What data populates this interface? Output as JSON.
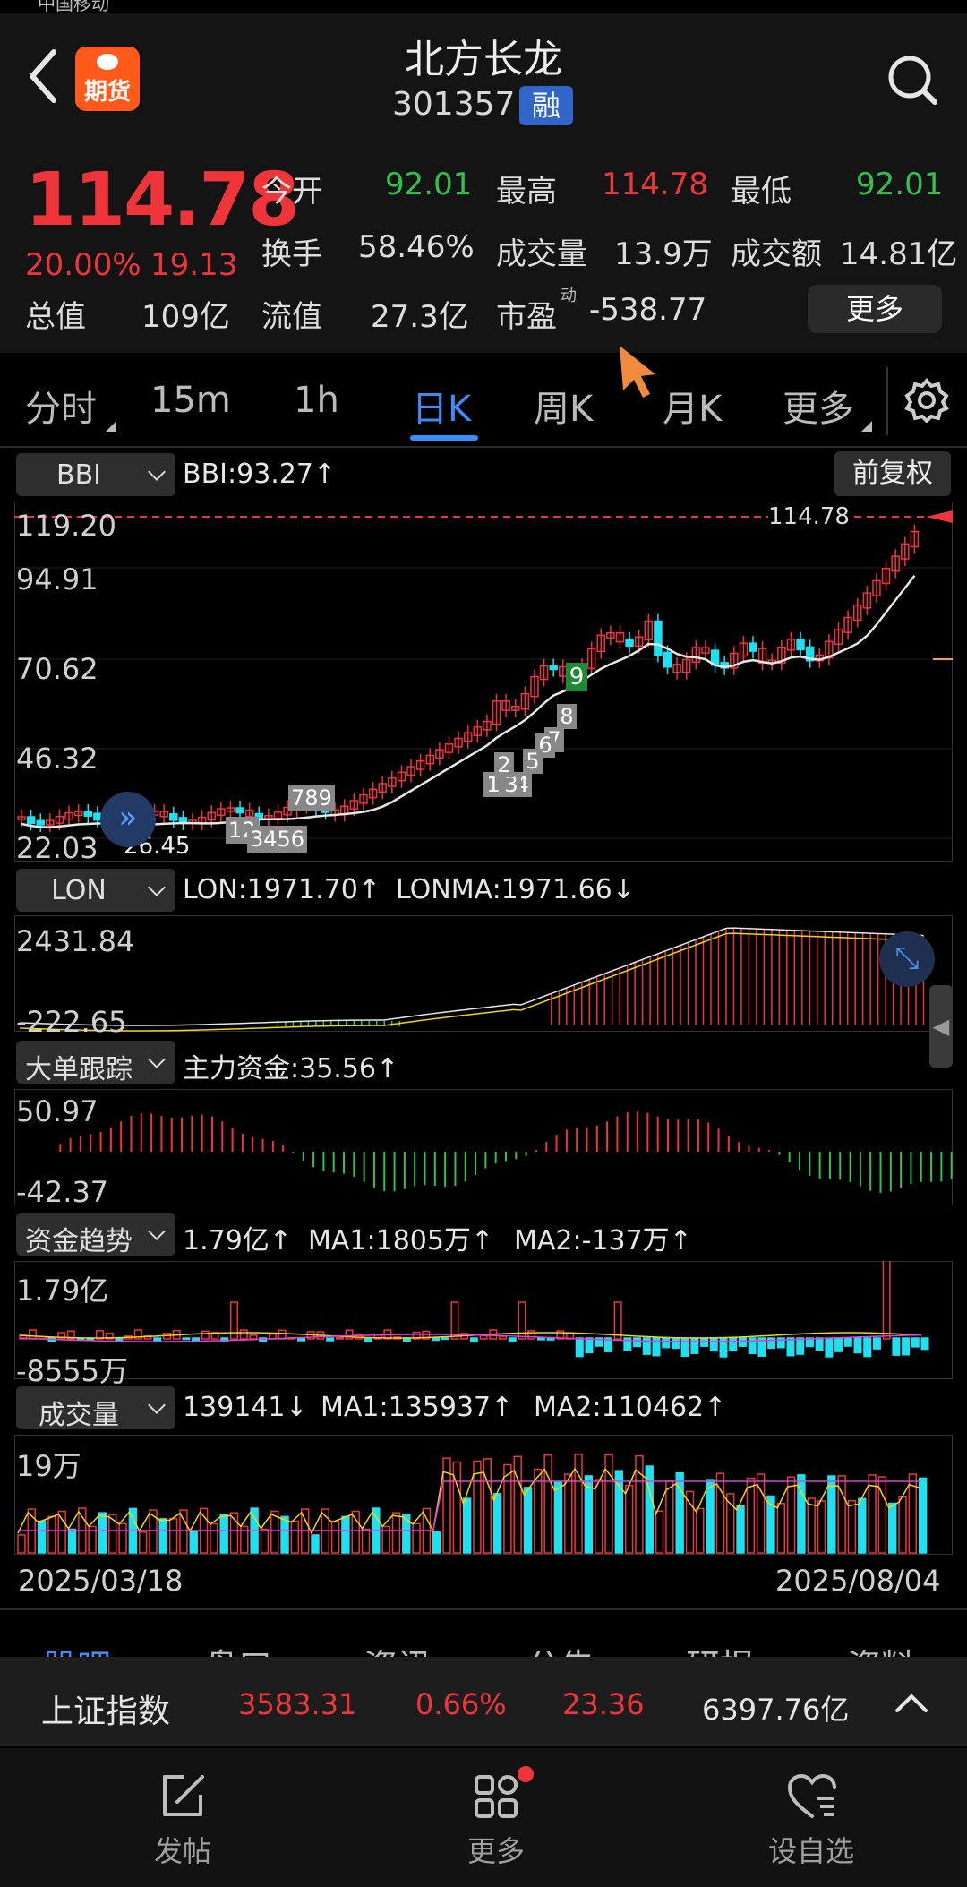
{
  "status": {
    "carrier": "中国移动"
  },
  "header": {
    "title": "北方长龙",
    "code": "301357",
    "margin_tag": "融",
    "futures_badge": "期货"
  },
  "quote": {
    "price": "114.78",
    "change_pct": "20.00%",
    "change_amt": "19.13",
    "fields": {
      "open_label": "今开",
      "open": "92.01",
      "high_label": "最高",
      "high": "114.78",
      "low_label": "最低",
      "low": "92.01",
      "turnover_label": "换手",
      "turnover": "58.46%",
      "volume_label": "成交量",
      "volume": "13.9万",
      "amount_label": "成交额",
      "amount": "14.81亿",
      "mktcap_label": "总值",
      "mktcap": "109亿",
      "float_label": "流值",
      "float": "27.3亿",
      "pe_label": "市盈",
      "pe_sup": "动",
      "pe": "-538.77"
    },
    "more_label": "更多"
  },
  "tabs": [
    {
      "label": "分时"
    },
    {
      "label": "15m"
    },
    {
      "label": "1h"
    },
    {
      "label": "日K"
    },
    {
      "label": "周K"
    },
    {
      "label": "月K"
    },
    {
      "label": "更多"
    }
  ],
  "chart": {
    "main": {
      "indicator": "BBI",
      "readout": "BBI:93.27↑",
      "adjust_label": "前复权",
      "last_price_tag": "114.78",
      "axis": [
        "119.20",
        "94.91",
        "70.62",
        "46.32",
        "22.03"
      ],
      "low_marker": "26.45",
      "seq_marks": [
        "9",
        "8",
        "7",
        "6",
        "5",
        "4",
        "3",
        "2",
        "1",
        "789",
        "12",
        "3456"
      ]
    },
    "lon": {
      "indicator": "LON",
      "readout_a": "LON:1971.70↑",
      "readout_b": "LONMA:1971.66↓",
      "axis": [
        "2431.84",
        "-222.65"
      ]
    },
    "bigorder": {
      "indicator": "大单跟踪",
      "readout": "主力资金:35.56↑",
      "axis": [
        "50.97",
        "-42.37"
      ]
    },
    "fundtrend": {
      "indicator": "资金趋势",
      "readout_a": "1.79亿↑",
      "readout_b": "MA1:1805万↑",
      "readout_c": "MA2:-137万↑",
      "axis": [
        "1.79亿",
        "-8555万"
      ]
    },
    "volume": {
      "indicator": "成交量",
      "readout_a": "139141↓",
      "readout_b": "MA1:135937↑",
      "readout_c": "MA2:110462↑",
      "axis": [
        "19万"
      ],
      "date_start": "2025/03/18",
      "date_end": "2025/08/04"
    }
  },
  "lower_tabs": [
    "股吧",
    "盘口",
    "资讯",
    "公告",
    "研报",
    "资料"
  ],
  "index_bar": {
    "name": "上证指数",
    "value": "3583.31",
    "pct": "0.66%",
    "chg": "23.36",
    "amount": "6397.76亿"
  },
  "nav": [
    {
      "label": "发帖",
      "icon": "compose-icon"
    },
    {
      "label": "更多",
      "icon": "grid-icon"
    },
    {
      "label": "设自选",
      "icon": "heart-list-icon"
    }
  ],
  "colors": {
    "up": "#f0353a",
    "down": "#1ee0f0",
    "accent": "#3b8cf5",
    "ma1": "#f2d60f",
    "ma2": "#e33be6"
  }
}
